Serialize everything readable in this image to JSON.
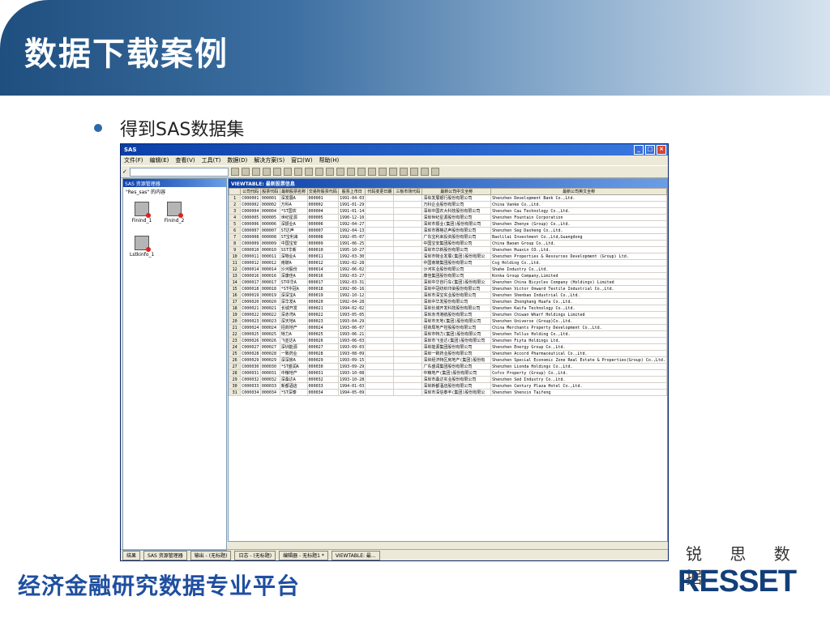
{
  "slide": {
    "title": "数据下载案例",
    "bullet": "得到SAS数据集",
    "footer": "经济金融研究数据专业平台",
    "logo_cn": "锐 思 数 据",
    "logo_en": "RESSET"
  },
  "sas": {
    "window_title": "SAS",
    "menu": [
      "文件(F)",
      "编辑(E)",
      "查看(V)",
      "工具(T)",
      "数据(D)",
      "解决方案(S)",
      "窗口(W)",
      "帮助(H)"
    ],
    "explorer_title": "SAS 资源管理器",
    "explorer_sub": "\"Res_sas\" 的内容",
    "libs": [
      "Finind_1",
      "Finind_2",
      "Lstkinfo_1"
    ],
    "viewtable_title": "VIEWTABLE: 最新股票信息",
    "columns": [
      "公司代码",
      "股票代码",
      "最新股票名称",
      "交易所股票代码",
      "股票上市日",
      "代码变更日期",
      "三板市场代码",
      "最新公司中文全称",
      "最新公司英文全称"
    ],
    "rows": [
      [
        "1",
        "C000001",
        "000001",
        "深发展A",
        "000001",
        "1991-04-03",
        "深圳发展银行股份有限公司",
        "Shenzhen Development Bank Co.,Ltd."
      ],
      [
        "2",
        "C000002",
        "000002",
        "万科A",
        "000002",
        "1991-01-29",
        "万科企业股份有限公司",
        "China Vanke Co.,Ltd."
      ],
      [
        "3",
        "C000004",
        "000004",
        "*ST国农",
        "000004",
        "1991-01-14",
        "深圳中国农大科技股份有限公司",
        "Shenzhen Cau Technology Co.,Ltd."
      ],
      [
        "4",
        "C000005",
        "000005",
        "世纪星源",
        "000005",
        "1990-12-10",
        "深圳世纪星源股份有限公司",
        "Shenzhen Fountain Corporation"
      ],
      [
        "5",
        "C000006",
        "000006",
        "深振业A",
        "000006",
        "1992-04-27",
        "深圳市振业(集团)股份有限公司",
        "Shenzhen Zhenye (Group) Co.,Ltd."
      ],
      [
        "6",
        "C000007",
        "000007",
        "ST达声",
        "000007",
        "1992-04-13",
        "深圳市赛格达声股份有限公司",
        "Shenzhen Seg Dasheng Co.,Ltd."
      ],
      [
        "7",
        "C000008",
        "000008",
        "ST宝利来",
        "000008",
        "1992-05-07",
        "广东宝利来投资股份有限公司",
        "Baolilai Investment Co.,Ltd,Guangdong"
      ],
      [
        "8",
        "C000009",
        "000009",
        "中国宝安",
        "000009",
        "1991-06-25",
        "中国宝安集团股份有限公司",
        "China Baoan Group Co.,Ltd."
      ],
      [
        "9",
        "C000010",
        "000010",
        "SST华新",
        "000010",
        "1995-10-27",
        "深圳市华新股份有限公司",
        "Shenzhen Huaxin CO.,Ltd."
      ],
      [
        "10",
        "C000011",
        "000011",
        "深物业A",
        "000011",
        "1992-03-30",
        "深圳市物业发展(集团)股份有限公",
        "Shenzhen Properties & Resources Development (Group) Ltd."
      ],
      [
        "11",
        "C000012",
        "000012",
        "南玻A",
        "000012",
        "1992-02-28",
        "中国南玻集团股份有限公司",
        "Csg Holding Co.,Ltd."
      ],
      [
        "12",
        "C000014",
        "000014",
        "沙河股份",
        "000014",
        "1992-06-02",
        "沙河实业股份有限公司",
        "Shahe Industry Co.,Ltd."
      ],
      [
        "13",
        "C000016",
        "000016",
        "深康佳A",
        "000016",
        "1992-03-27",
        "康佳集团股份有限公司",
        "Konka Group Company,Limited"
      ],
      [
        "14",
        "C000017",
        "000017",
        "ST中华A",
        "000017",
        "1992-03-31",
        "深圳中华自行车(集团)股份有限公",
        "Shenzhen China Bicycles Company (Holdings) Limited"
      ],
      [
        "15",
        "C000018",
        "000018",
        "*ST中冠A",
        "000018",
        "1992-06-16",
        "深圳中冠纺织印染股份有限公司",
        "Shenzhen Victor Onward Textile Industrial Co.,Ltd."
      ],
      [
        "16",
        "C000019",
        "000019",
        "深深宝A",
        "000019",
        "1992-10-12",
        "深圳市深宝实业股份有限公司",
        "Shenzhen Shenbao Industrial Co.,Ltd."
      ],
      [
        "17",
        "C000020",
        "000020",
        "深华发A",
        "000020",
        "1992-04-28",
        "深圳中华发股份有限公司",
        "Shenzhen Zhonghang Huafa Co.,Ltd."
      ],
      [
        "18",
        "C000021",
        "000021",
        "长城开发",
        "000021",
        "1994-02-02",
        "深圳长城开发科技股份有限公司",
        "Shenzhen Kaifa Technology Co.,Ltd."
      ],
      [
        "19",
        "C000022",
        "000022",
        "深赤湾A",
        "000022",
        "1993-05-05",
        "深圳赤湾港航股份有限公司",
        "Shenzhen Chiwan Wharf Holdings Limited"
      ],
      [
        "20",
        "C000023",
        "000023",
        "深天地A",
        "000023",
        "1993-04-29",
        "深圳市天地(集团)股份有限公司",
        "Shenzhen Universe (Group)Co.,Ltd."
      ],
      [
        "21",
        "C000024",
        "000024",
        "招商地产",
        "000024",
        "1993-06-07",
        "招商局地产控股股份有限公司",
        "China Merchants Property Development Co.,Ltd."
      ],
      [
        "22",
        "C000025",
        "000025",
        "特力A",
        "000025",
        "1993-06-21",
        "深圳市特力(集团)股份有限公司",
        "Shenzhen Tellus Holding Co.,Ltd."
      ],
      [
        "23",
        "C000026",
        "000026",
        "飞亚达A",
        "000026",
        "1993-06-03",
        "深圳市飞亚达(集团)股份有限公司",
        "Shenzhen Fiyta Holdings Ltd."
      ],
      [
        "24",
        "C000027",
        "000027",
        "深圳能源",
        "000027",
        "1993-09-03",
        "深圳能源集团股份有限公司",
        "Shenzhen Energy Group Co.,Ltd."
      ],
      [
        "25",
        "C000028",
        "000028",
        "一致药业",
        "000028",
        "1993-08-09",
        "深圳一致药业股份有限公司",
        "Shenzhen Accord Pharmaceutical Co.,Ltd."
      ],
      [
        "26",
        "C000029",
        "000029",
        "深深房A",
        "000029",
        "1993-09-15",
        "深圳经济特区房地产(集团)股份有",
        "Shenzhen Special Economic Zone Real Estate & Properties(Group) Co.,Ltd."
      ],
      [
        "27",
        "C000030",
        "000030",
        "*ST盛润A",
        "000030",
        "1993-09-29",
        "广东盛润集团股份有限公司",
        "Shenzhen Lionda Holdings Co.,Ltd."
      ],
      [
        "28",
        "C000031",
        "000031",
        "中粮地产",
        "000031",
        "1993-10-08",
        "中粮地产(集团)股份有限公司",
        "Cofco Property (Group) Co.,Ltd."
      ],
      [
        "29",
        "C000032",
        "000032",
        "深桑达A",
        "000032",
        "1993-10-28",
        "深圳市桑达实业股份有限公司",
        "Shenzhen Sed Industry Co.,Ltd."
      ],
      [
        "30",
        "C000033",
        "000033",
        "新都酒店",
        "000033",
        "1994-01-03",
        "深圳新都酒店股份有限公司",
        "Shenzhen Century Plaza Hotel Co.,Ltd."
      ],
      [
        "31",
        "C000034",
        "000034",
        "*ST深泰",
        "000034",
        "1994-05-09",
        "深圳市深信泰丰(集团)股份有限公",
        "Shenzhen Shenxin Taifeng"
      ]
    ],
    "tasks": [
      "结果",
      "SAS 资源管理器",
      "输出 - (无标题)",
      "日志 - (无标题)",
      "编辑器 - 无标题1 *",
      "VIEWTABLE: 最..."
    ]
  }
}
